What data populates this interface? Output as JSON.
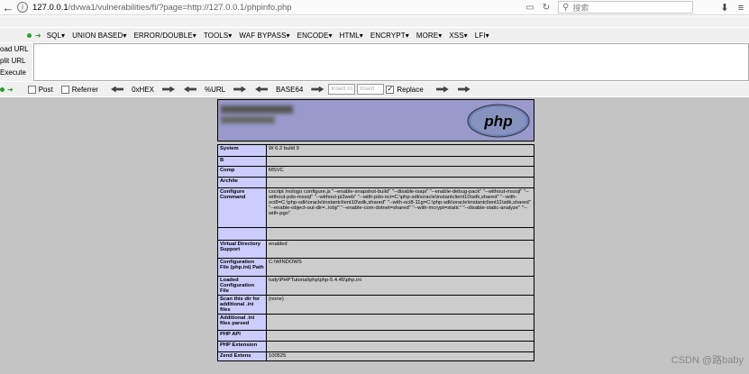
{
  "browser": {
    "url_host": "127.0.0.1",
    "url_path": "/dvwa1/vulnerabilities/fi/?page=http://127.0.0.1/phpinfo.php",
    "search_placeholder": "搜索"
  },
  "hackbar": {
    "menus": [
      "SQL▾",
      "UNION BASED▾",
      "ERROR/DOUBLE▾",
      "TOOLS▾",
      "WAF BYPASS▾",
      "ENCODE▾",
      "HTML▾",
      "ENCRYPT▾",
      "MORE▾",
      "XSS▾",
      "LFI▾"
    ],
    "actions": {
      "load": "oad URL",
      "split": "plit URL",
      "execute": "Execute"
    },
    "options": {
      "post": "Post",
      "referrer": "Referrer",
      "hex": "0xHEX",
      "url": "%URL",
      "base64": "BASE64",
      "insert_to": "Insert to r",
      "insert_rep": "Insert rep",
      "replace": "Replace"
    }
  },
  "phpinfo": {
    "logo_text": "php",
    "rows": [
      {
        "key": "System",
        "value": "W                                              6.2 build 9"
      },
      {
        "key": "B",
        "value": ""
      },
      {
        "key": "Comp",
        "value": "MSVC"
      },
      {
        "key": "Archite",
        "value": ""
      },
      {
        "key": "Configure Command",
        "value": "cscript /nologo configure.js \"--enable-snapshot-build\" \"--disable-isapi\" \"--enable-debug-pack\" \"--without-mssql\" \"--without-pdo-mssql\" \"--without-pi3web\" \"--with-pdo-oci=C:\\php-sdk\\oracle\\instantclient10\\sdk,shared\" \"--with-oci8=C:\\php-sdk\\oracle\\instantclient10\\sdk,shared\" \"--with-oci8-11g=C:\\php-sdk\\oracle\\instantclient11\\sdk,shared\" \"--enable-object-out-dir=../obj/\" \"--enable-com-dotnet=shared\" \"--with-mcrypt=static\" \"--disable-static-analyze\" \"--with-pgo\""
      },
      {
        "key": "",
        "value": ""
      },
      {
        "key": "Virtual Directory Support",
        "value": "enabled"
      },
      {
        "key": "Configuration File (php.ini) Path",
        "value": "C:\\WINDOWS"
      },
      {
        "key": "Loaded Configuration File",
        "value": "           tudy\\PHPTutorial\\php\\php-5.4.45\\php.ini"
      },
      {
        "key": "Scan this dir for additional .ini files",
        "value": "(none)"
      },
      {
        "key": "Additional .ini files parsed",
        "value": ""
      },
      {
        "key": "PHP API",
        "value": ""
      },
      {
        "key": "PHP Extension",
        "value": ""
      },
      {
        "key": "Zend Extens",
        "value": "           100525"
      }
    ]
  },
  "watermark": "CSDN @路baby"
}
